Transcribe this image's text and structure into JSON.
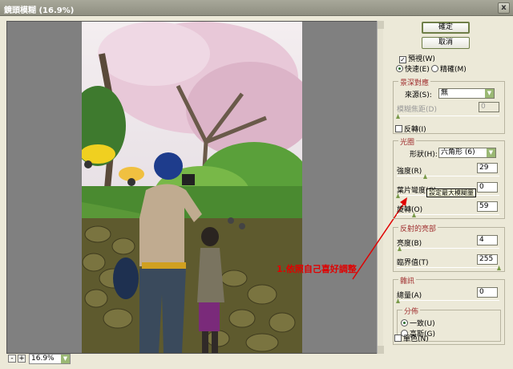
{
  "window": {
    "title": "鏡頭模糊 (16.9%)",
    "close_label": "x"
  },
  "preview": {
    "zoom_out_label": "-",
    "zoom_in_label": "+",
    "zoom_value": "16.9%"
  },
  "buttons": {
    "ok": "確定",
    "cancel": "取消"
  },
  "preview_opts": {
    "preview_label": "預視(W)",
    "fast_label": "快速(E)",
    "precise_label": "精確(M)"
  },
  "depth_map": {
    "title": "景深對應",
    "source_label": "來源(S):",
    "source_value": "無",
    "blur_focal_label": "模糊焦距(D)",
    "blur_focal_value": "0",
    "invert_label": "反轉(I)"
  },
  "iris": {
    "title": "光圈",
    "shape_label": "形狀(H):",
    "shape_value": "六角形 (6)",
    "radius_label": "強度(R)",
    "radius_value": "29",
    "curvature_label": "葉片彎度(C)",
    "curvature_value": "0",
    "rotation_label": "旋轉(O)",
    "rotation_value": "59",
    "tooltip": "設定最大模糊量"
  },
  "specular": {
    "title": "反射的亮部",
    "brightness_label": "亮度(B)",
    "brightness_value": "4",
    "threshold_label": "臨界值(T)",
    "threshold_value": "255"
  },
  "noise": {
    "title": "雜訊",
    "amount_label": "總量(A)",
    "amount_value": "0",
    "distribution_title": "分佈",
    "uniform_label": "一致(U)",
    "gaussian_label": "高斯(G)",
    "mono_label": "單色(N)"
  },
  "annotation": {
    "text": "1.依照自己喜好調整"
  }
}
